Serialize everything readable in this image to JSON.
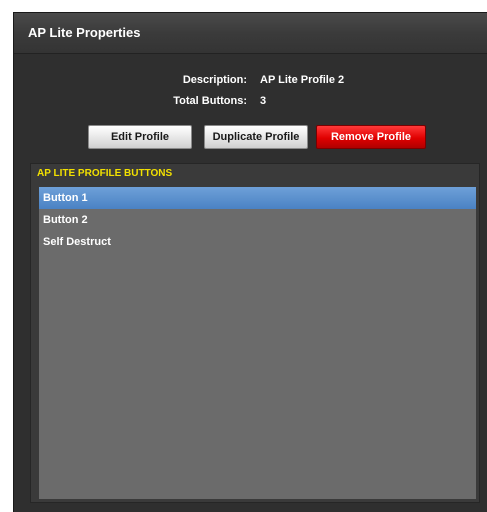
{
  "window": {
    "title": "AP Lite Properties"
  },
  "info": {
    "description_label": "Description:",
    "description_value": "AP Lite Profile 2",
    "total_buttons_label": "Total Buttons:",
    "total_buttons_value": "3"
  },
  "actions": {
    "edit_label": "Edit Profile",
    "duplicate_label": "Duplicate Profile",
    "remove_label": "Remove Profile"
  },
  "list": {
    "header": "AP LITE PROFILE BUTTONS",
    "items": [
      {
        "label": "Button 1",
        "selected": true
      },
      {
        "label": "Button 2",
        "selected": false
      },
      {
        "label": "Self Destruct",
        "selected": false
      }
    ]
  },
  "colors": {
    "header_yellow": "#f2e000",
    "selection_blue": "#5b90cf",
    "remove_red": "#e00000"
  }
}
